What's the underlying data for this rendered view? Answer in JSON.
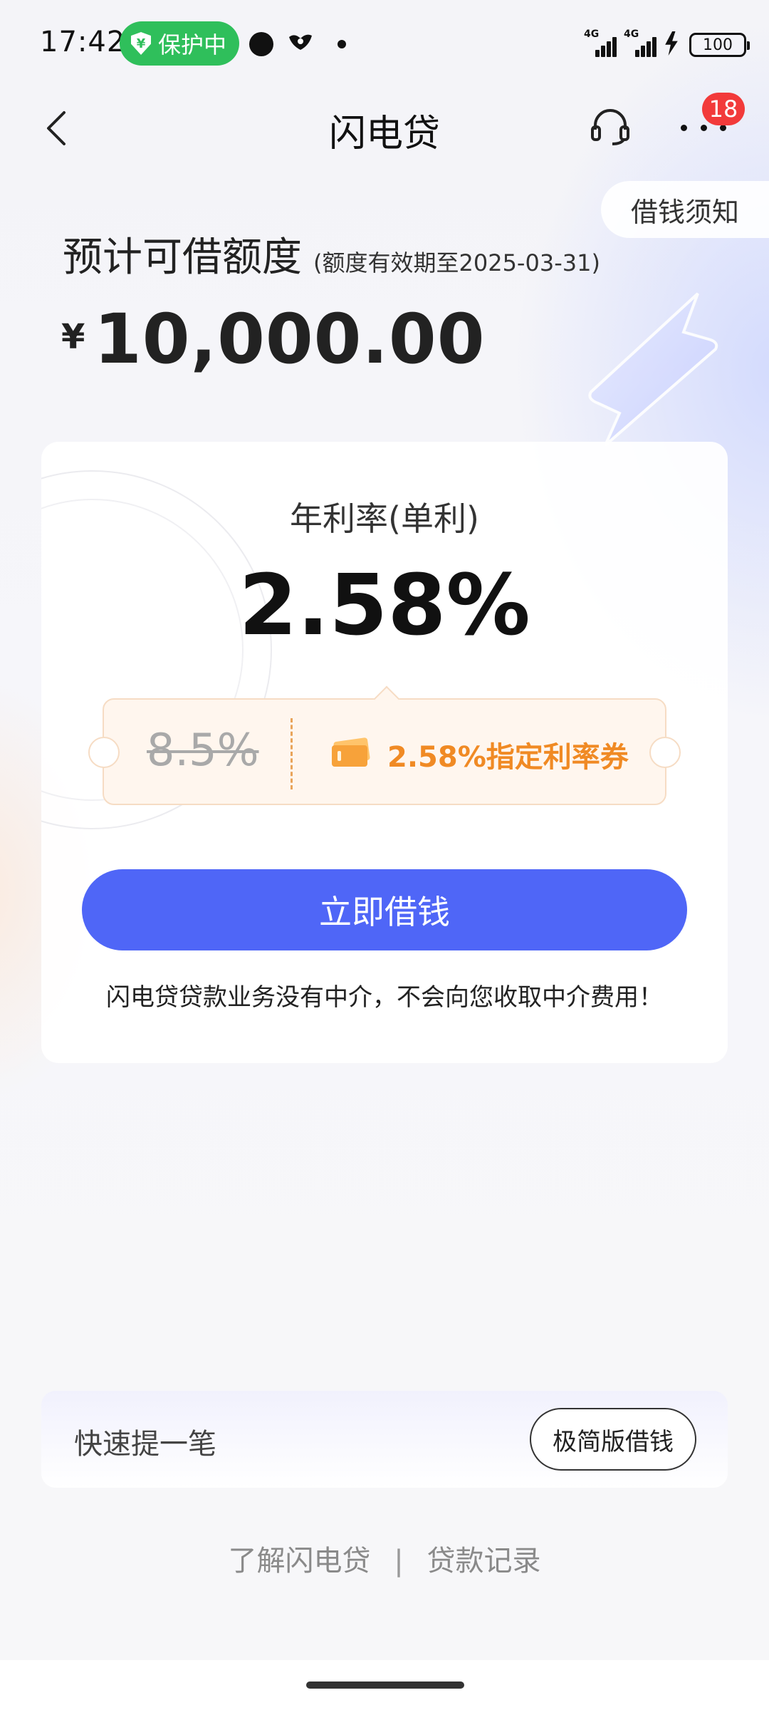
{
  "status_bar": {
    "time": "17:42",
    "protect_label": "保护中",
    "signal_labels": [
      "4G",
      "4G"
    ],
    "battery": "100"
  },
  "header": {
    "title": "闪电贷",
    "badge_count": "18",
    "icons": [
      "back-icon",
      "headset-icon",
      "more-icon"
    ]
  },
  "notice": {
    "label": "借钱须知"
  },
  "credit": {
    "label": "预计可借额度",
    "valid_until": "(额度有效期至2025-03-31)",
    "currency": "¥",
    "amount": "10,000.00"
  },
  "rate": {
    "label": "年利率(单利)",
    "value": "2.58%"
  },
  "coupon": {
    "old_rate": "8.5%",
    "text": "2.58%指定利率券"
  },
  "actions": {
    "borrow_label": "立即借钱",
    "disclaimer": "闪电贷贷款业务没有中介，不会向您收取中介费用！"
  },
  "quick": {
    "label": "快速提一笔",
    "button_label": "极简版借钱"
  },
  "footer": {
    "link_about": "了解闪电贷",
    "separator": "|",
    "link_records": "贷款记录"
  },
  "colors": {
    "primary": "#4f66f7",
    "coupon_text": "#f08a24",
    "badge": "#f23a3a",
    "protect_green": "#2fbf5b"
  }
}
